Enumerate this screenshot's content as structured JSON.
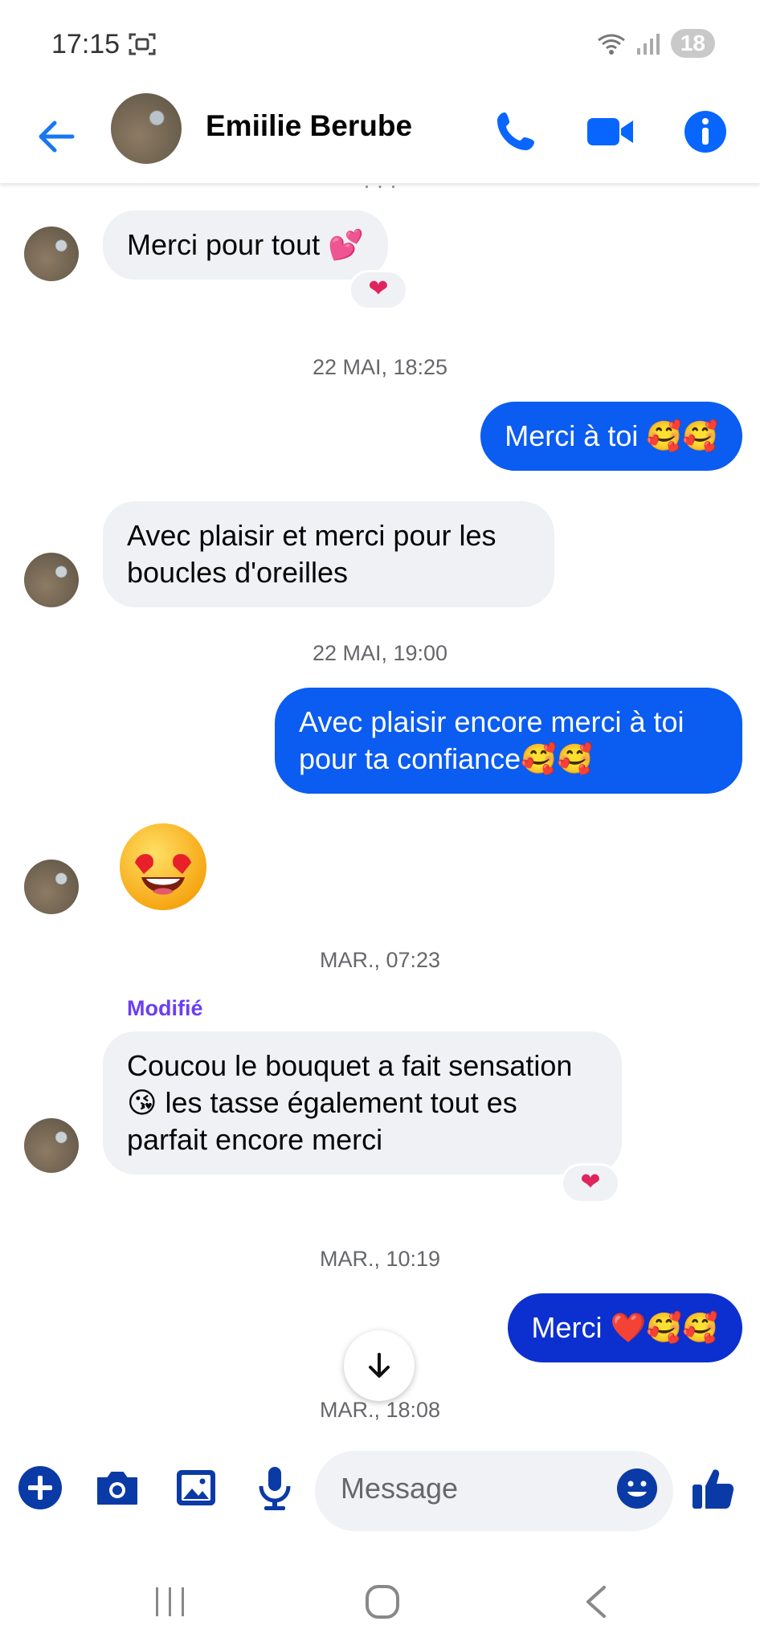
{
  "status_bar": {
    "time": "17:15",
    "battery": "18"
  },
  "header": {
    "contact_name": "Emiilie Berube"
  },
  "timestamps": [
    "22 MAI, 18:25",
    "22 MAI, 19:00",
    "MAR., 07:23",
    "MAR., 10:19",
    "MAR., 18:08"
  ],
  "messages": [
    {
      "text": "Merci pour tout 💕"
    },
    {
      "text": "Merci à toi 🥰🥰"
    },
    {
      "text": "Avec plaisir et merci pour les boucles d'oreilles"
    },
    {
      "text": "Avec plaisir encore merci à toi pour ta confiance🥰🥰"
    },
    {
      "text": "😍"
    },
    {
      "text": "Coucou le bouquet a fait sensation 😘 les tasse également tout es parfait encore merci",
      "edited_label": "Modifié"
    },
    {
      "text": "Merci ❤️🥰🥰"
    }
  ],
  "reactions": [
    "❤",
    "❤"
  ],
  "composer": {
    "placeholder": "Message"
  },
  "colors": {
    "accent": "#0866ff",
    "outgoing": "#0b5cf0",
    "outgoing_dark": "#0c2fd0",
    "incoming": "#eff1f4",
    "edited": "#6b3ff0"
  }
}
